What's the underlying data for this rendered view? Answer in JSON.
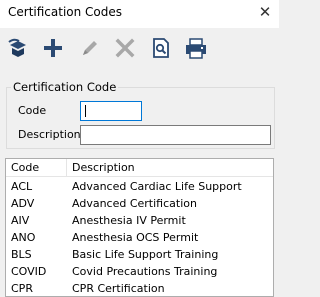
{
  "window": {
    "title": "Certification Codes",
    "close_glyph": "✕"
  },
  "toolbar": {
    "buttons": [
      {
        "name": "save-exit",
        "icon": "save-exit-icon"
      },
      {
        "name": "add",
        "icon": "plus-icon"
      },
      {
        "name": "edit",
        "icon": "pencil-icon",
        "disabled": true
      },
      {
        "name": "delete",
        "icon": "x-icon",
        "disabled": true
      },
      {
        "name": "preview",
        "icon": "print-preview-icon"
      },
      {
        "name": "print",
        "icon": "printer-icon"
      }
    ]
  },
  "form": {
    "group_title": "Certification Code",
    "code_label": "Code",
    "code_value": "",
    "description_label": "Description",
    "description_value": ""
  },
  "table": {
    "columns": [
      "Code",
      "Description"
    ],
    "rows": [
      [
        "ACL",
        "Advanced Cardiac Life Support"
      ],
      [
        "ADV",
        "Advanced Certification"
      ],
      [
        "AIV",
        "Anesthesia IV Permit"
      ],
      [
        "ANO",
        "Anesthesia OCS Permit"
      ],
      [
        "BLS",
        "Basic Life Support Training"
      ],
      [
        "COVID",
        "Covid Precautions Training"
      ],
      [
        "CPR",
        "CPR Certification"
      ]
    ]
  },
  "colors": {
    "accent": "#0078d7",
    "toolbar_icon": "#2b4a73",
    "disabled": "#a0a0a0"
  }
}
